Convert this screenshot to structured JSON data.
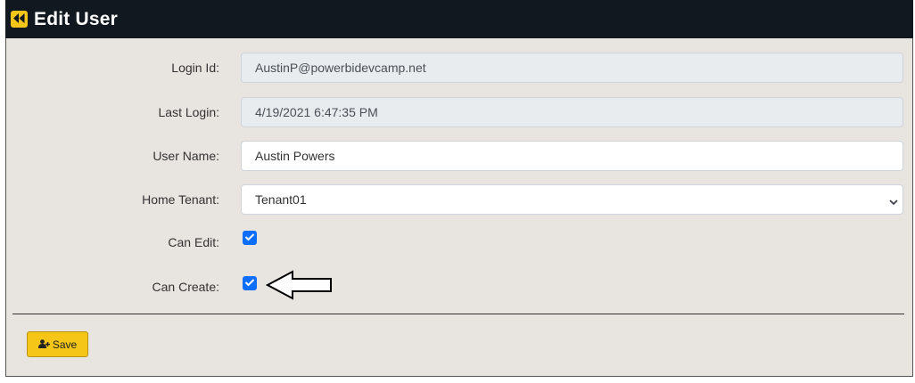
{
  "header": {
    "title": "Edit User",
    "back_icon": "rewind-icon",
    "accent": "#f5c518",
    "background": "#111820"
  },
  "form": {
    "login_id": {
      "label": "Login Id:",
      "value": "AustinP@powerbidevcamp.net"
    },
    "last_login": {
      "label": "Last Login:",
      "value": "4/19/2021 6:47:35 PM"
    },
    "user_name": {
      "label": "User Name:",
      "value": "Austin Powers"
    },
    "home_tenant": {
      "label": "Home Tenant:",
      "selected": "Tenant01"
    },
    "can_edit": {
      "label": "Can Edit:",
      "checked": true
    },
    "can_create": {
      "label": "Can Create:",
      "checked": true
    }
  },
  "actions": {
    "save_label": "Save",
    "save_icon": "user-plus-icon"
  },
  "colors": {
    "checkbox": "#0d6efd",
    "panel": "#e8e4df",
    "readonly_field": "#e9ecef"
  }
}
